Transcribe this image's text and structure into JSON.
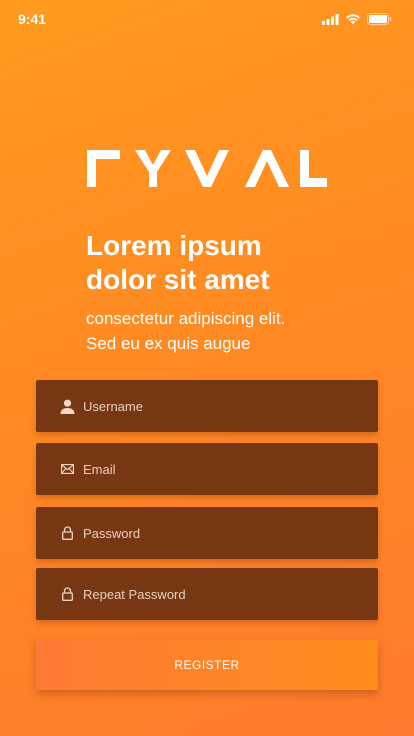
{
  "status_bar": {
    "time": "9:41",
    "icons": [
      "signal-icon",
      "wifi-icon",
      "battery-icon"
    ]
  },
  "logo": {
    "text": "ΓYVΛL",
    "color": "#ffffff"
  },
  "headline": {
    "line1": "Lorem ipsum",
    "line2": "dolor sit amet"
  },
  "subtext": {
    "line1": "consectetur adipiscing elit.",
    "line2": "Sed eu ex quis augue"
  },
  "form": {
    "username": {
      "placeholder": "Username",
      "value": "",
      "icon": "user-icon"
    },
    "email": {
      "placeholder": "Email",
      "value": "",
      "icon": "envelope-icon"
    },
    "password": {
      "placeholder": "Password",
      "value": "",
      "icon": "lock-icon"
    },
    "repeat_password": {
      "placeholder": "Repeat Password",
      "value": "",
      "icon": "lock-icon"
    },
    "register_label": "REGISTER"
  },
  "colors": {
    "background_top": "#ff9a1f",
    "background_bottom": "#ff7a2e",
    "field_background": "#773713",
    "button_gradient_start": "#ff7a35",
    "button_gradient_end": "#ff8c1c",
    "text": "#ffffff"
  }
}
